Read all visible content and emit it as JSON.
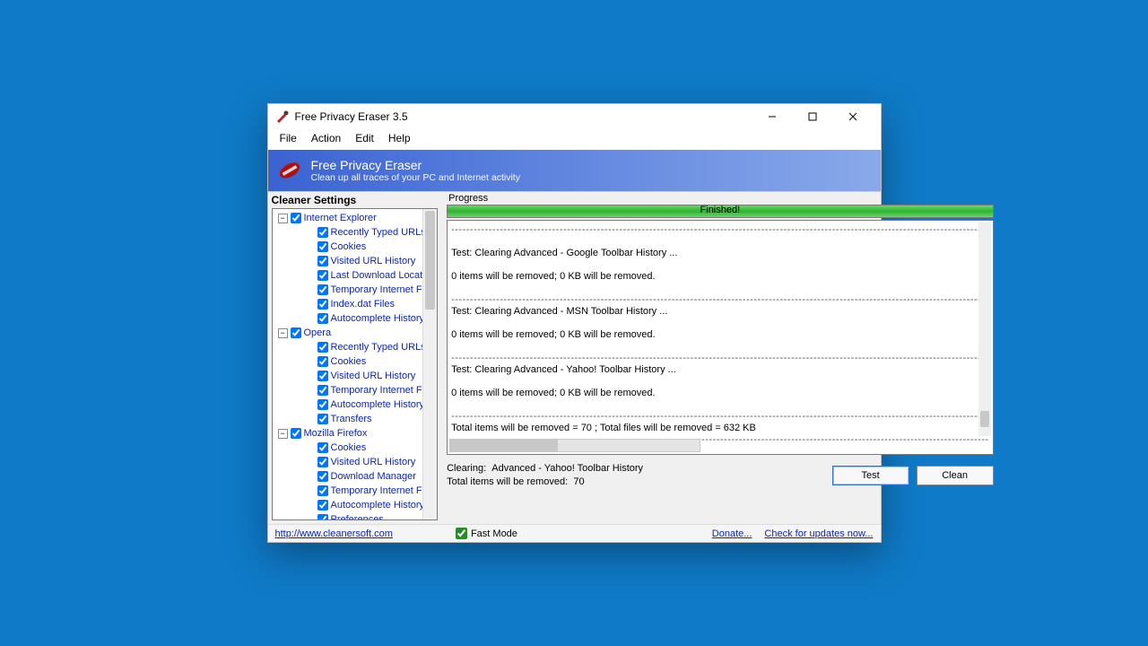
{
  "window": {
    "title": "Free Privacy Eraser 3.5",
    "buttons": {
      "min": "—",
      "max": "☐",
      "close": "✕"
    }
  },
  "menu": {
    "file": "File",
    "action": "Action",
    "edit": "Edit",
    "help": "Help"
  },
  "banner": {
    "title": "Free Privacy Eraser",
    "subtitle": "Clean up all traces of your PC and Internet activity"
  },
  "left": {
    "header": "Cleaner Settings",
    "nodes": [
      {
        "level": 0,
        "exp": true,
        "label": "Internet Explorer"
      },
      {
        "level": 1,
        "label": "Recently Typed URLs"
      },
      {
        "level": 1,
        "label": "Cookies"
      },
      {
        "level": 1,
        "label": "Visited URL History"
      },
      {
        "level": 1,
        "label": "Last Download Location"
      },
      {
        "level": 1,
        "label": "Temporary Internet Files"
      },
      {
        "level": 1,
        "label": "Index.dat Files"
      },
      {
        "level": 1,
        "label": "Autocomplete History"
      },
      {
        "level": 0,
        "exp": true,
        "label": "Opera"
      },
      {
        "level": 1,
        "label": "Recently Typed URLs"
      },
      {
        "level": 1,
        "label": "Cookies"
      },
      {
        "level": 1,
        "label": "Visited URL History"
      },
      {
        "level": 1,
        "label": "Temporary Internet Files"
      },
      {
        "level": 1,
        "label": "Autocomplete History"
      },
      {
        "level": 1,
        "label": "Transfers"
      },
      {
        "level": 0,
        "exp": true,
        "label": "Mozilla Firefox"
      },
      {
        "level": 1,
        "label": "Cookies"
      },
      {
        "level": 1,
        "label": "Visited URL History"
      },
      {
        "level": 1,
        "label": "Download Manager"
      },
      {
        "level": 1,
        "label": "Temporary Internet Files"
      },
      {
        "level": 1,
        "label": "Autocomplete History"
      },
      {
        "level": 1,
        "label": "Preferences"
      }
    ]
  },
  "right": {
    "progress_label": "Progress",
    "progress_text": "Finished!",
    "log": {
      "l1": "Test: Clearing Advanced - Google Toolbar History ...",
      "l2": "0 items will be removed; 0 KB will be removed.",
      "l3": "Test: Clearing Advanced - MSN Toolbar History ...",
      "l4": "0 items will be removed; 0 KB will be removed.",
      "l5": "Test: Clearing Advanced - Yahoo! Toolbar History ...",
      "l6": "0 items will be removed; 0 KB will be removed.",
      "l7": "Total items will be removed = 70 ; Total files will be removed = 632 KB"
    },
    "status": {
      "clearing_label": "Clearing:",
      "clearing_value": "Advanced - Yahoo! Toolbar History",
      "total_label": "Total items will be removed:",
      "total_value": "70"
    },
    "buttons": {
      "test": "Test",
      "clean": "Clean"
    }
  },
  "footer": {
    "url": "http://www.cleanersoft.com",
    "fastmode": "Fast Mode",
    "donate": "Donate...",
    "updates": "Check for updates now..."
  }
}
